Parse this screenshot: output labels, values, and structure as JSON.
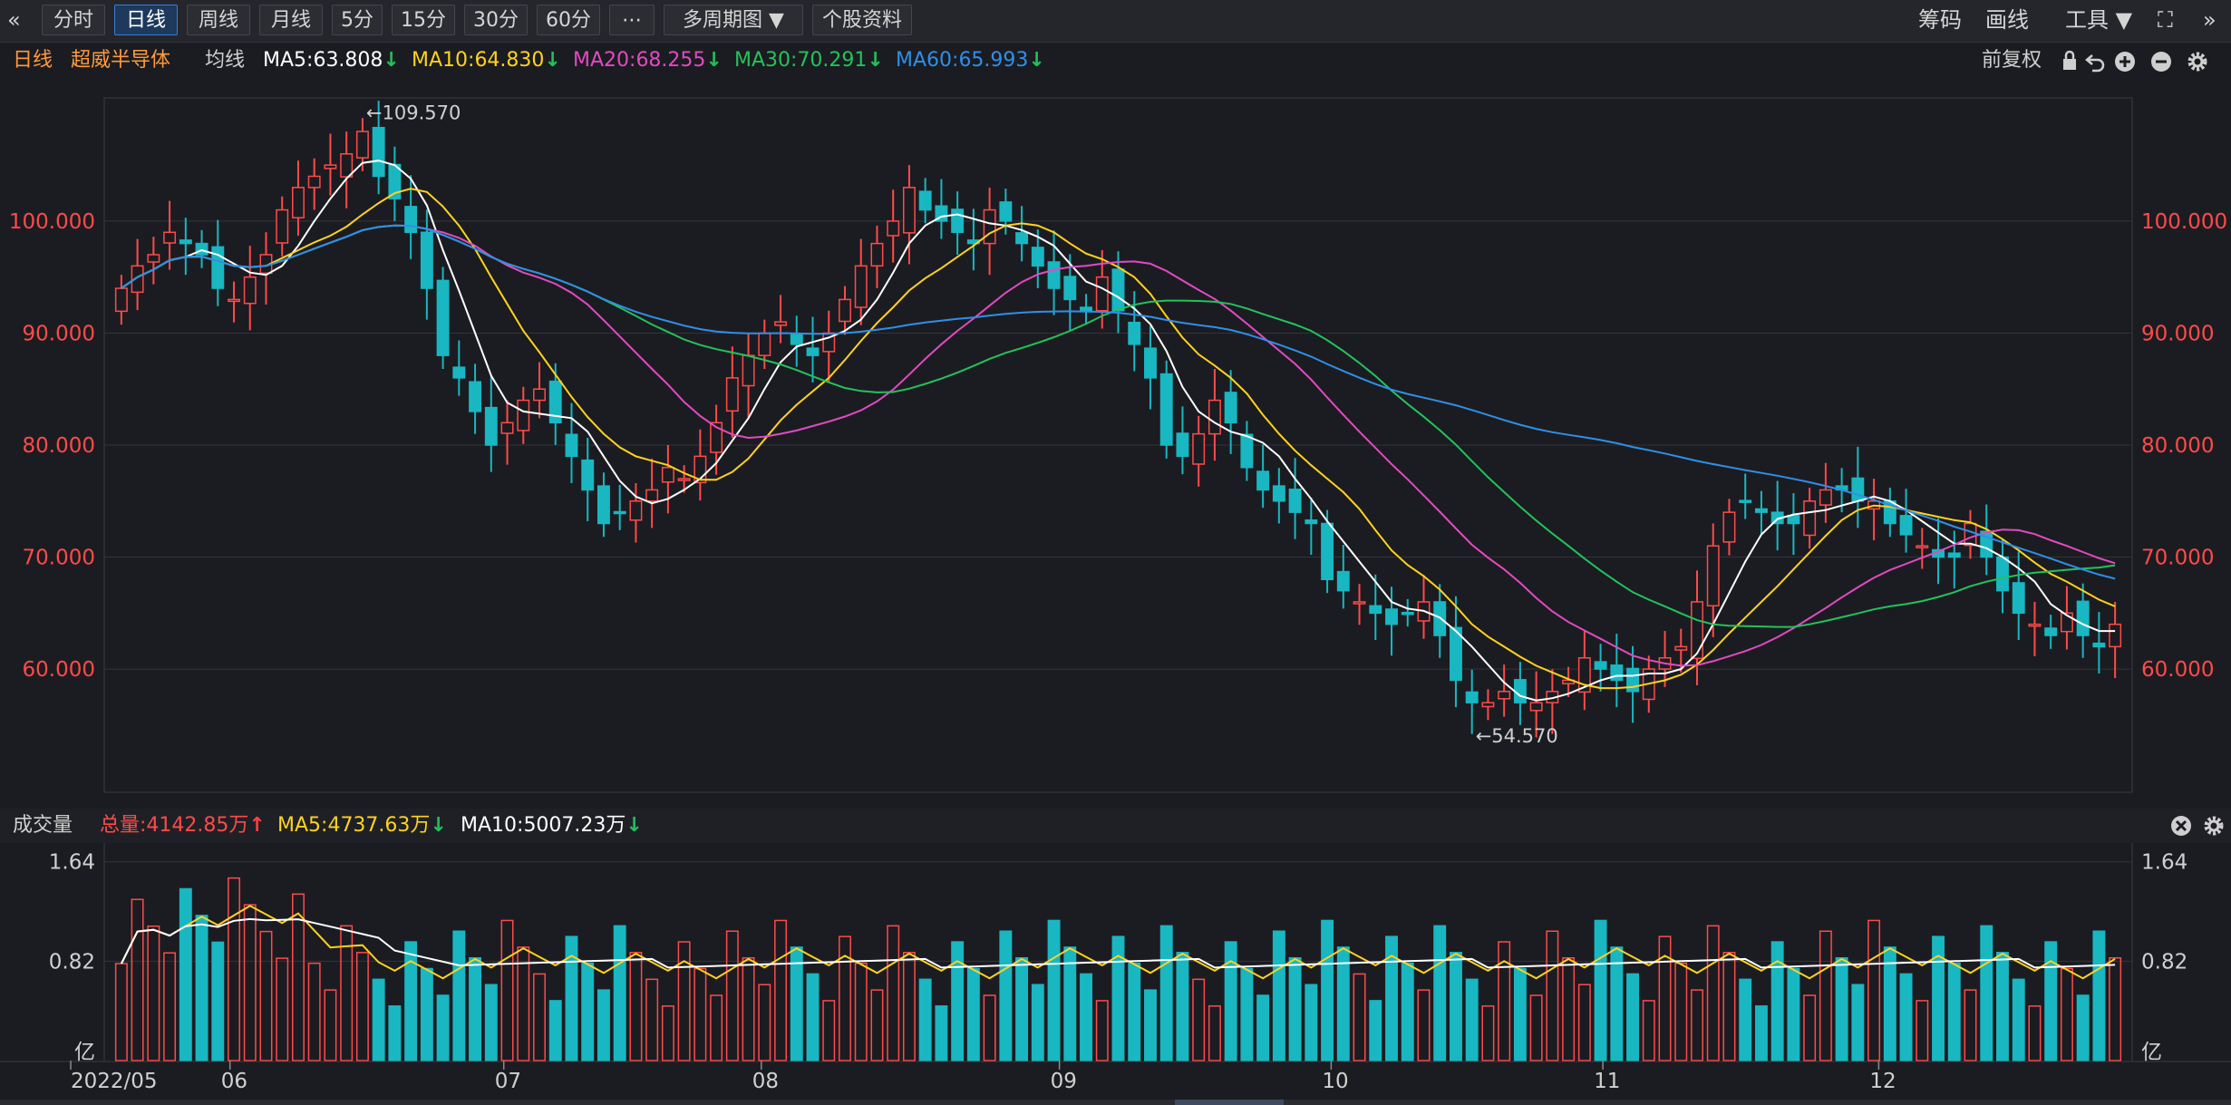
{
  "toolbar": {
    "collapse_icon": "«",
    "buttons": [
      "分时",
      "日线",
      "周线",
      "月线",
      "5分",
      "15分",
      "30分",
      "60分",
      "⋯",
      "多周期图 ▼",
      "个股资料"
    ],
    "active_index": 1,
    "right": {
      "chips": "筹码",
      "draw": "画线",
      "tools": "工具 ▼",
      "fullscreen": "⛶",
      "expand": "»"
    }
  },
  "ma_bar": {
    "period": "日线",
    "stock_name": "超威半导体",
    "ma_label": "均线",
    "ma5": "MA5:63.808",
    "ma10": "MA10:64.830",
    "ma20": "MA20:68.255",
    "ma30": "MA30:70.291",
    "ma60": "MA60:65.993",
    "adjust": "前复权",
    "colors": {
      "ma5": "#ffffff",
      "ma10": "#ffd21f",
      "ma20": "#e24ac0",
      "ma30": "#23c25b",
      "ma60": "#2f8fe8",
      "period": "#ff9a3c",
      "stock": "#ff9a3c"
    }
  },
  "vol_bar": {
    "label": "成交量",
    "total": "总量:4142.85万",
    "ma5": "MA5:4737.63万",
    "ma10": "MA10:5007.23万"
  },
  "chart_data": {
    "type": "candlestick",
    "price_axis": {
      "ticks": [
        "100.000",
        "90.000",
        "80.000",
        "70.000",
        "60.000"
      ],
      "values": [
        100,
        90,
        80,
        70,
        60
      ],
      "range": [
        49,
        111
      ]
    },
    "max_marker": "←109.570",
    "min_marker": "←54.570",
    "x_labels": [
      "2022/05",
      "06",
      "07",
      "08",
      "09",
      "10",
      "11",
      "12"
    ],
    "volume_axis": {
      "ticks": [
        "1.64",
        "0.82",
        "亿"
      ],
      "values": [
        1.64,
        0.82,
        0
      ],
      "unit": "亿"
    },
    "colors": {
      "up": "#ff4a4a",
      "down": "#18b7c2",
      "grid": "#33343a"
    },
    "price_path_close": [
      94,
      96,
      97,
      99,
      98,
      97,
      94,
      93,
      95,
      97,
      101,
      103,
      104,
      105,
      106,
      108,
      104,
      102,
      99,
      94,
      88,
      86,
      83,
      80,
      82,
      84,
      85,
      82,
      79,
      76,
      73,
      74,
      75,
      76,
      78,
      77,
      79,
      82,
      86,
      88,
      90,
      91,
      89,
      88,
      90,
      93,
      96,
      98,
      100,
      103,
      101,
      100,
      99,
      98,
      101,
      100,
      98,
      96,
      94,
      93,
      92,
      95,
      92,
      89,
      86,
      80,
      79,
      81,
      84,
      82,
      78,
      76,
      75,
      74,
      73,
      68,
      67,
      66,
      65,
      64,
      65,
      66,
      63,
      59,
      57,
      57,
      58,
      57,
      57,
      58,
      59,
      61,
      60,
      59,
      58,
      60,
      61,
      62,
      66,
      71,
      74,
      75,
      74,
      73,
      73,
      75,
      76,
      76,
      75,
      75,
      73,
      72,
      71,
      70,
      70,
      73,
      70,
      67,
      65,
      64,
      63,
      65,
      63,
      62,
      64
    ]
  }
}
